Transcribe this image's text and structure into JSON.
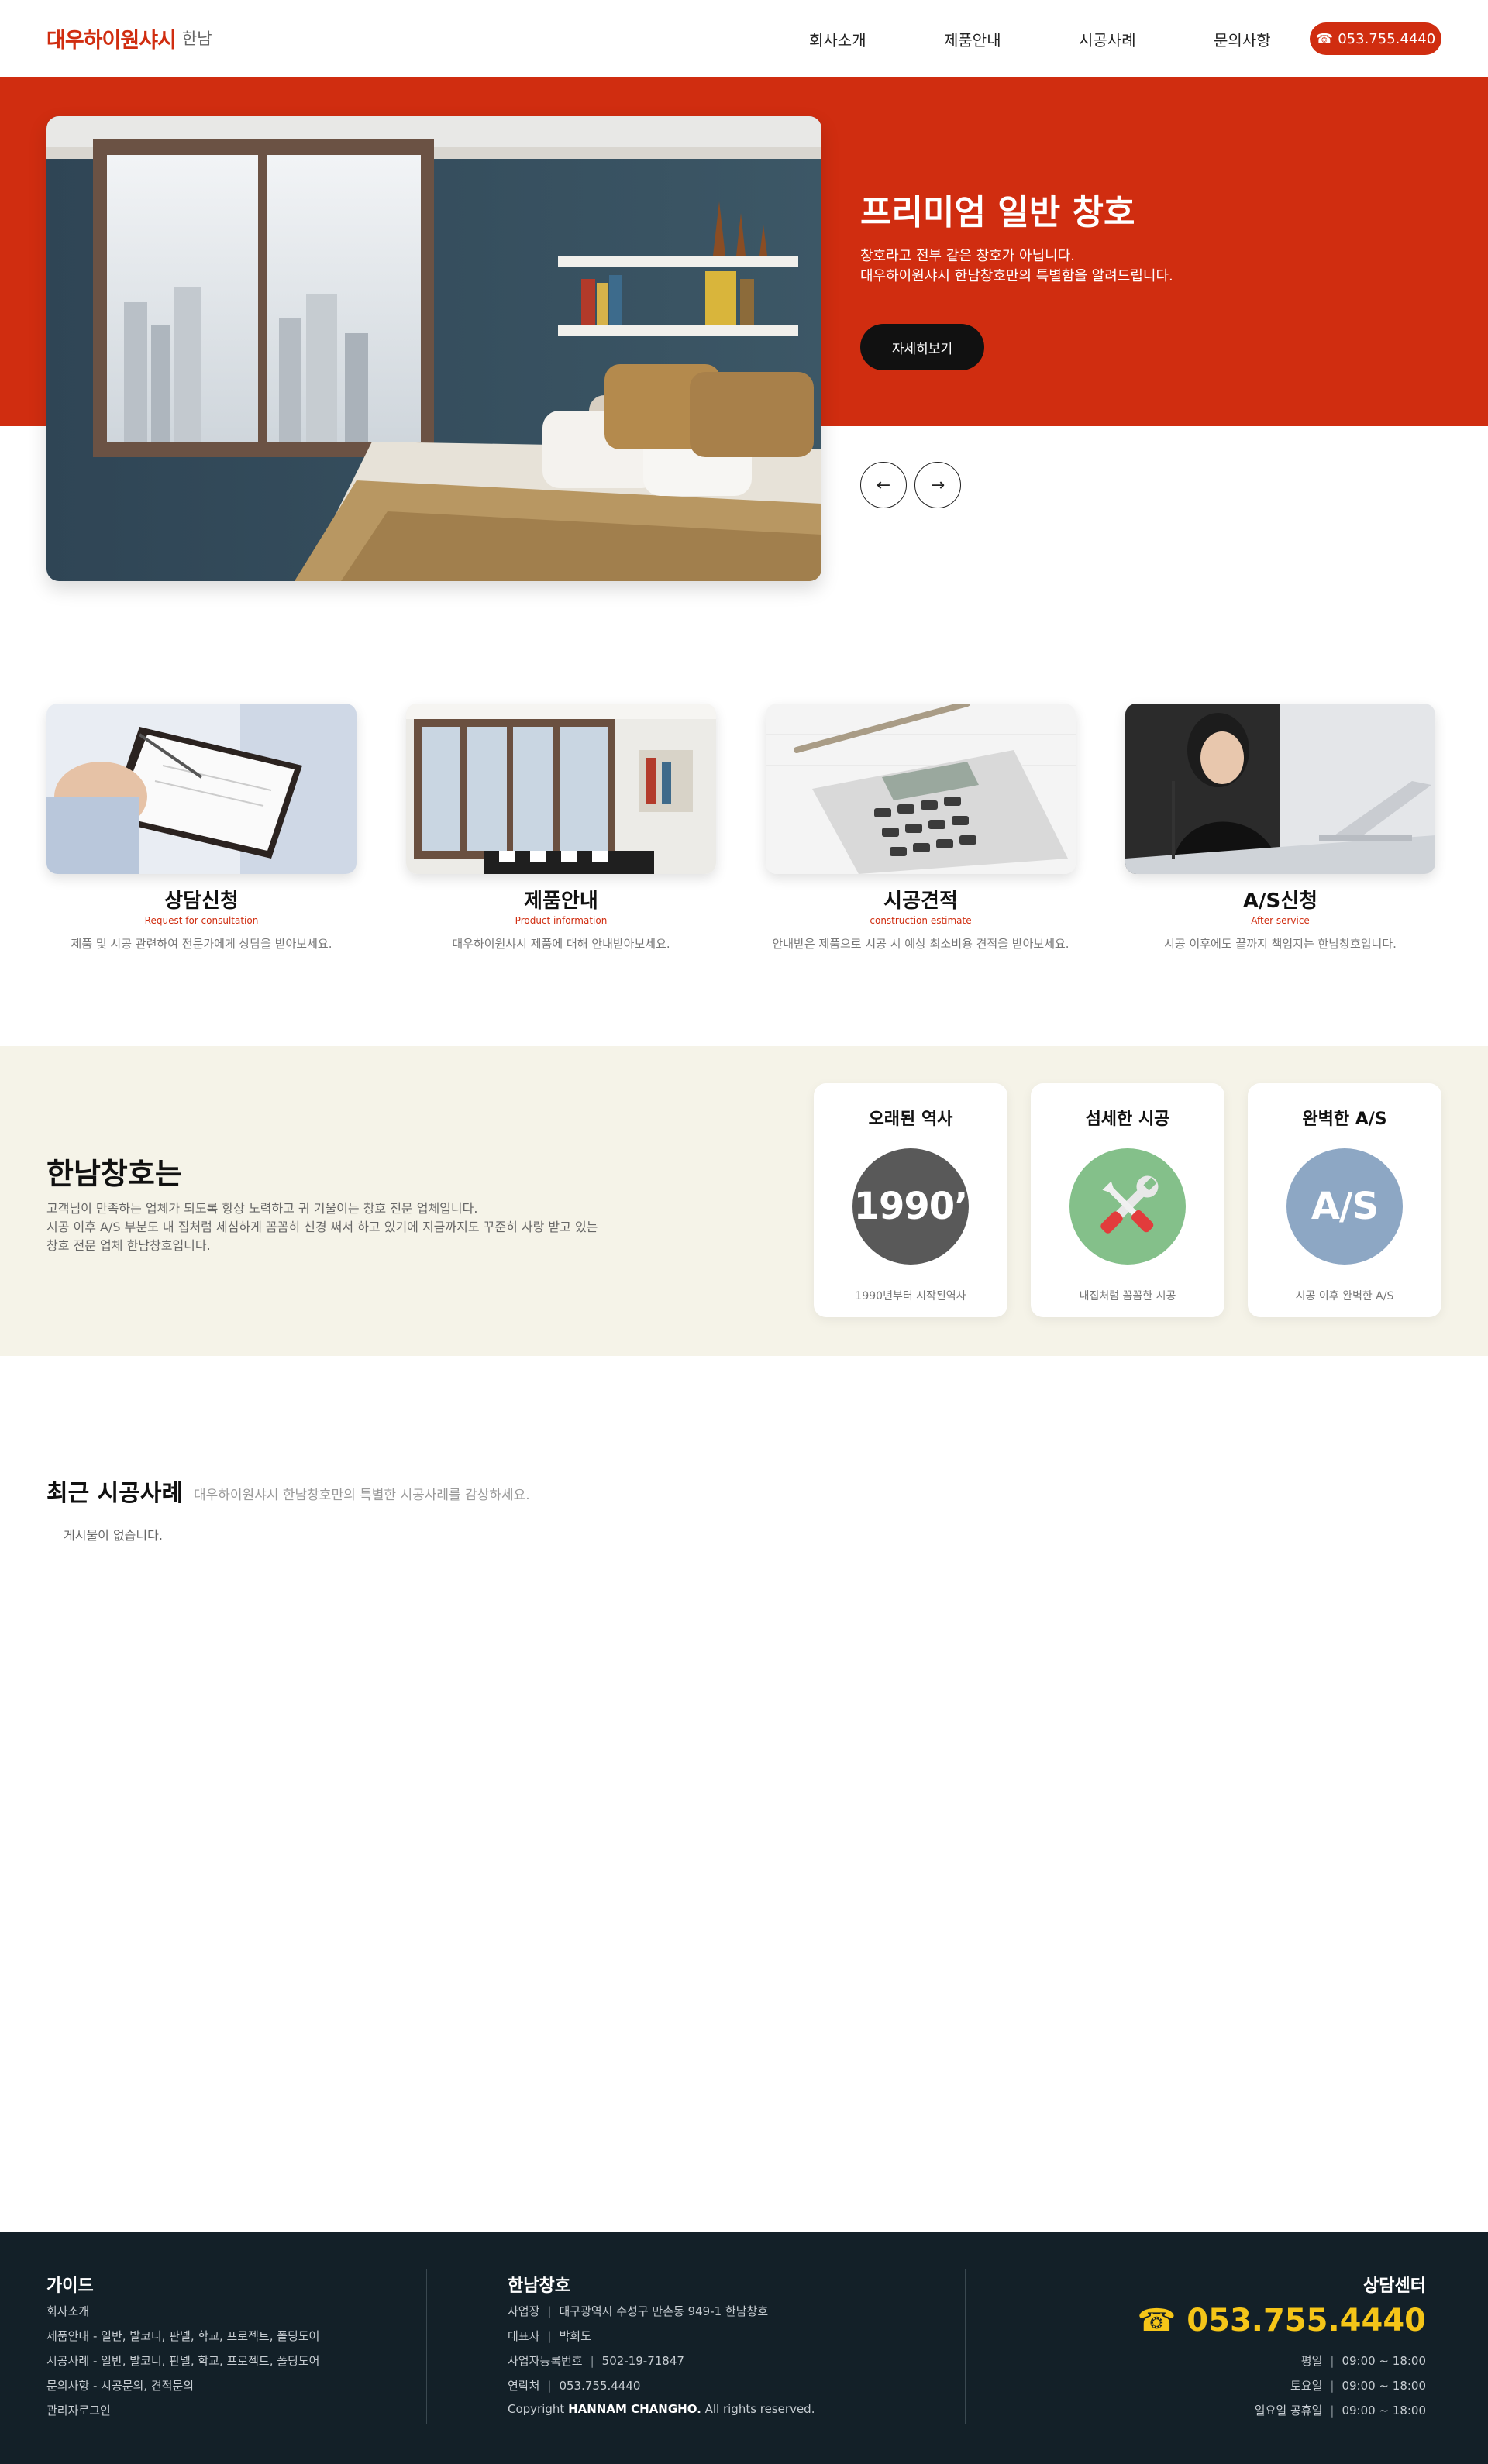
{
  "header": {
    "logo_text": "대우하이원샤시",
    "logo_sub": "한남",
    "nav": [
      "회사소개",
      "제품안내",
      "시공사례",
      "문의사항"
    ],
    "phone_icon": "phone-icon",
    "phone": "053.755.4440"
  },
  "hero": {
    "title": "프리미엄 일반 창호",
    "desc_line1": "창호라고 전부 같은 창호가 아닙니다.",
    "desc_line2": "대우하이원샤시 한남창호만의 특별함을 알려드립니다.",
    "button": "자세히보기",
    "prev_icon": "arrow-left-icon",
    "next_icon": "arrow-right-icon",
    "accent_color": "#d02d10"
  },
  "services": [
    {
      "title": "상담신청",
      "sub": "Request for consultation",
      "desc": "제품 및 시공 관련하여 전문가에게 상담을 받아보세요."
    },
    {
      "title": "제품안내",
      "sub": "Product information",
      "desc": "대우하이원샤시 제품에 대해 안내받아보세요."
    },
    {
      "title": "시공견적",
      "sub": "construction estimate",
      "desc": "안내받은 제품으로 시공 시 예상 최소비용 견적을 받아보세요."
    },
    {
      "title": "A/S신청",
      "sub": "After service",
      "desc": "시공 이후에도 끝까지 책임지는 한남창호입니다."
    }
  ],
  "about": {
    "title": "한남창호는",
    "line1": "고객님이 만족하는 업체가 되도록 항상 노력하고 귀 기울이는 창호 전문 업체입니다.",
    "line2": "시공 이후 A/S 부분도 내 집처럼 세심하게 꼼꼼히 신경 써서 하고 있기에 지금까지도 꾸준히 사랑 받고 있는",
    "line3": "창호 전문 업체 한남창호입니다.",
    "features": [
      {
        "title": "오래된 역사",
        "badge": "1990’",
        "desc": "1990년부터 시작된역사",
        "color": "#595959"
      },
      {
        "title": "섬세한 시공",
        "badge": "",
        "icon": "tools-icon",
        "desc": "내집처럼 꼼꼼한 시공",
        "color": "#84c08a"
      },
      {
        "title": "완벽한 A/S",
        "badge": "A/S",
        "desc": "시공 이후 완벽한 A/S",
        "color": "#8da7c4"
      }
    ]
  },
  "recent": {
    "title": "최근 시공사례",
    "sub": "대우하이원샤시 한남창호만의 특별한 시공사례를 감상하세요.",
    "empty": "게시물이 없습니다."
  },
  "footer": {
    "guide_title": "가이드",
    "guide_lines": [
      "회사소개",
      "제품안내 - 일반, 발코니, 판넬, 학교, 프로젝트, 폴딩도어",
      "시공사례 - 일반, 발코니, 판넬, 학교, 프로젝트, 폴딩도어",
      "문의사항 - 시공문의, 견적문의",
      "관리자로그인"
    ],
    "company_title": "한남창호",
    "company_rows": [
      {
        "label": "사업장",
        "value": "대구광역시 수성구 만촌동 949-1 한남창호"
      },
      {
        "label": "대표자",
        "value": "박희도"
      },
      {
        "label": "사업자등록번호",
        "value": "502-19-71847"
      },
      {
        "label": "연락처",
        "value": "053.755.4440"
      }
    ],
    "copyright_pre": "Copyright",
    "copyright_name": "HANNAM CHANGHO.",
    "copyright_post": "All rights reserved.",
    "center_title": "상담센터",
    "center_phone": "☎ 053.755.4440",
    "hours": [
      {
        "day": "평일",
        "time": "09:00 ~ 18:00"
      },
      {
        "day": "토요일",
        "time": "09:00 ~ 18:00"
      },
      {
        "day": "일요일 공휴일",
        "time": "09:00 ~ 18:00"
      }
    ],
    "phone_color": "#f5c518"
  }
}
